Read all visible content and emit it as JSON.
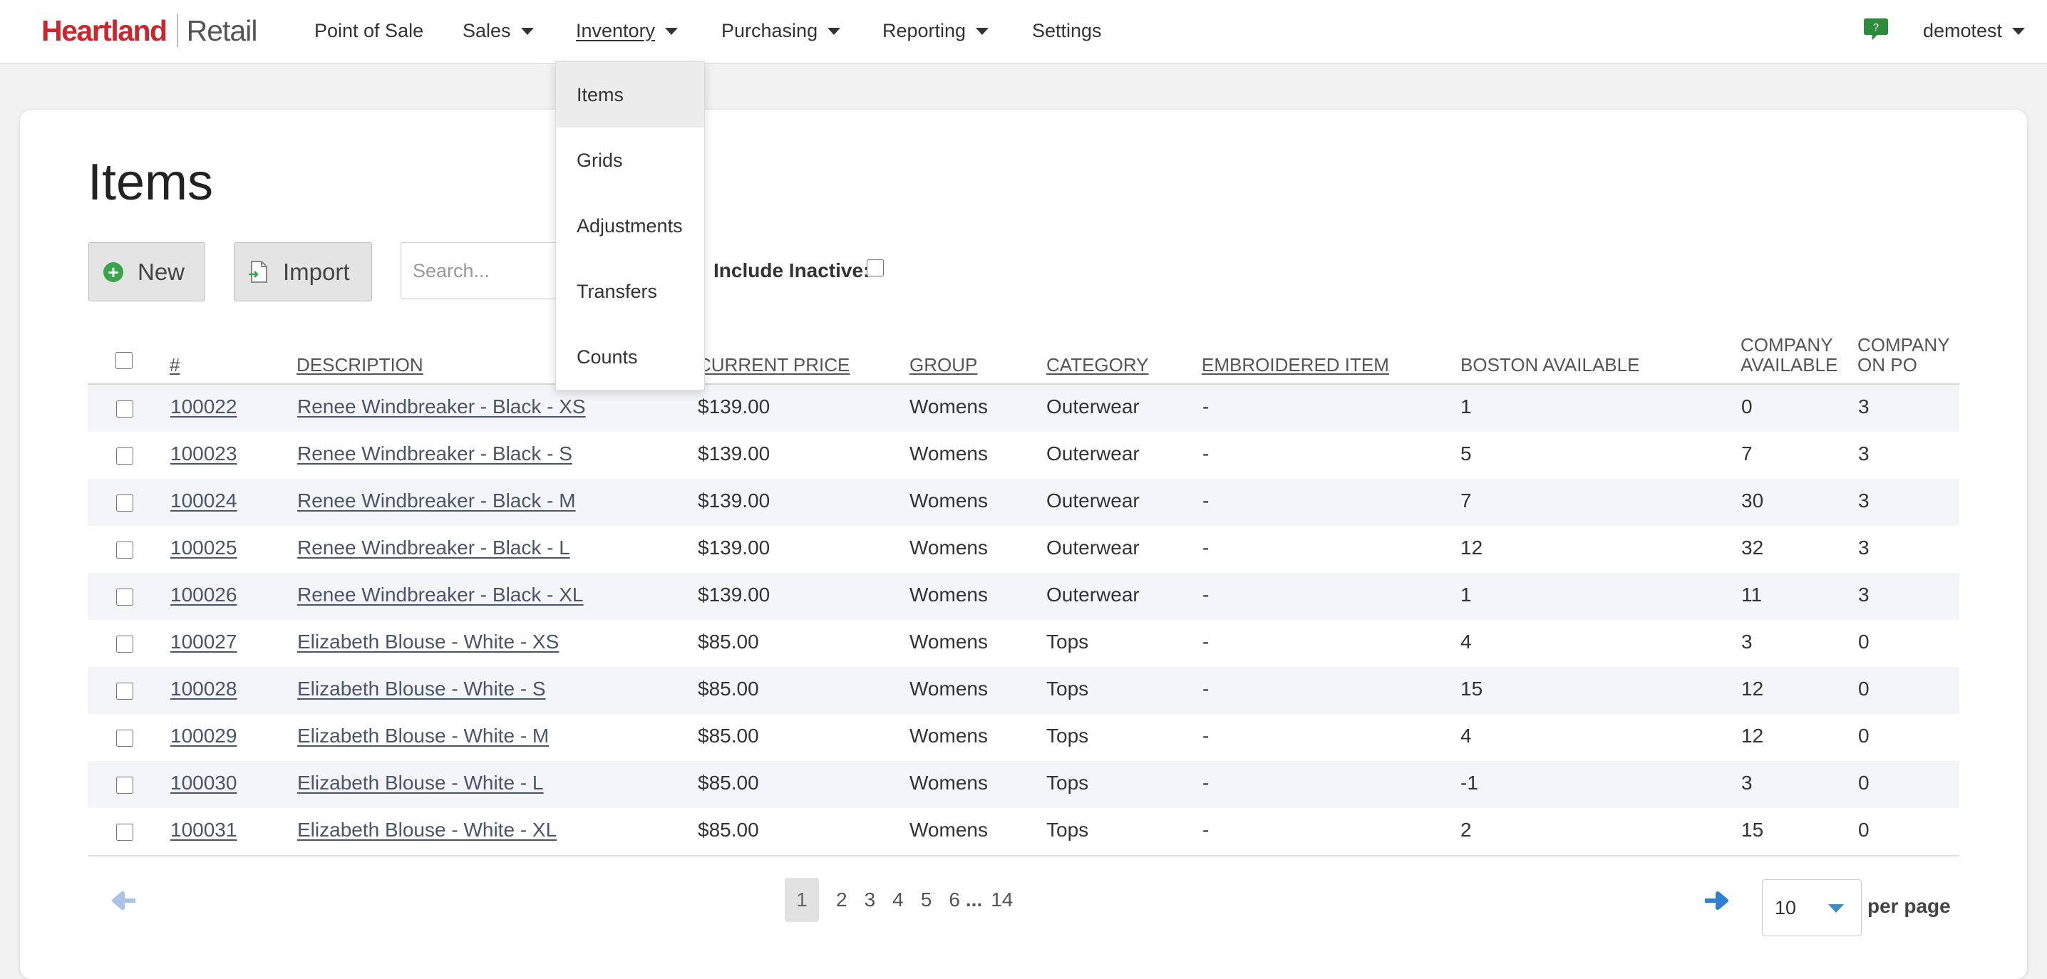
{
  "app": {
    "brand": "Heartland",
    "product": "Retail"
  },
  "nav": [
    {
      "label": "Point of Sale",
      "dropdown": false
    },
    {
      "label": "Sales",
      "dropdown": true
    },
    {
      "label": "Inventory",
      "dropdown": true,
      "active": true
    },
    {
      "label": "Purchasing",
      "dropdown": true
    },
    {
      "label": "Reporting",
      "dropdown": true
    },
    {
      "label": "Settings",
      "dropdown": false
    }
  ],
  "user": {
    "name": "demotest",
    "help_icon": "chat-help-icon"
  },
  "inventory_menu": [
    {
      "label": "Items",
      "selected": true
    },
    {
      "label": "Grids"
    },
    {
      "label": "Adjustments"
    },
    {
      "label": "Transfers"
    },
    {
      "label": "Counts"
    }
  ],
  "page": {
    "title": "Items"
  },
  "toolbar": {
    "new_label": "New",
    "import_label": "Import",
    "search_placeholder": "Search...",
    "include_inactive_label": "Include Inactive:",
    "include_inactive": false
  },
  "table": {
    "headers": [
      "#",
      "Description",
      "Current Price",
      "Group",
      "Category",
      "Embroidered Item",
      "Boston Available",
      "Company Available",
      "Company On PO"
    ],
    "rows": [
      {
        "id": "100022",
        "desc": "Renee Windbreaker - Black - XS",
        "price": "$139.00",
        "group": "Womens",
        "category": "Outerwear",
        "embroidered": "-",
        "boston": "1",
        "company": "0",
        "po": "3"
      },
      {
        "id": "100023",
        "desc": "Renee Windbreaker - Black - S",
        "price": "$139.00",
        "group": "Womens",
        "category": "Outerwear",
        "embroidered": "-",
        "boston": "5",
        "company": "7",
        "po": "3"
      },
      {
        "id": "100024",
        "desc": "Renee Windbreaker - Black - M",
        "price": "$139.00",
        "group": "Womens",
        "category": "Outerwear",
        "embroidered": "-",
        "boston": "7",
        "company": "30",
        "po": "3"
      },
      {
        "id": "100025",
        "desc": "Renee Windbreaker - Black - L",
        "price": "$139.00",
        "group": "Womens",
        "category": "Outerwear",
        "embroidered": "-",
        "boston": "12",
        "company": "32",
        "po": "3"
      },
      {
        "id": "100026",
        "desc": "Renee Windbreaker - Black - XL",
        "price": "$139.00",
        "group": "Womens",
        "category": "Outerwear",
        "embroidered": "-",
        "boston": "1",
        "company": "11",
        "po": "3"
      },
      {
        "id": "100027",
        "desc": "Elizabeth Blouse - White - XS",
        "price": "$85.00",
        "group": "Womens",
        "category": "Tops",
        "embroidered": "-",
        "boston": "4",
        "company": "3",
        "po": "0"
      },
      {
        "id": "100028",
        "desc": "Elizabeth Blouse - White - S",
        "price": "$85.00",
        "group": "Womens",
        "category": "Tops",
        "embroidered": "-",
        "boston": "15",
        "company": "12",
        "po": "0"
      },
      {
        "id": "100029",
        "desc": "Elizabeth Blouse - White - M",
        "price": "$85.00",
        "group": "Womens",
        "category": "Tops",
        "embroidered": "-",
        "boston": "4",
        "company": "12",
        "po": "0"
      },
      {
        "id": "100030",
        "desc": "Elizabeth Blouse - White - L",
        "price": "$85.00",
        "group": "Womens",
        "category": "Tops",
        "embroidered": "-",
        "boston": "-1",
        "company": "3",
        "po": "0"
      },
      {
        "id": "100031",
        "desc": "Elizabeth Blouse - White - XL",
        "price": "$85.00",
        "group": "Womens",
        "category": "Tops",
        "embroidered": "-",
        "boston": "2",
        "company": "15",
        "po": "0"
      }
    ]
  },
  "pagination": {
    "pages": [
      "1",
      "2",
      "3",
      "4",
      "5",
      "6"
    ],
    "current": "1",
    "ellipsis": "...",
    "last": "14",
    "per_page": "10",
    "per_page_label": "per page"
  },
  "colors": {
    "brand_red": "#c8282d",
    "link": "#4a5568",
    "accent_blue": "#2f80d0",
    "new_green": "#3aa44a"
  }
}
